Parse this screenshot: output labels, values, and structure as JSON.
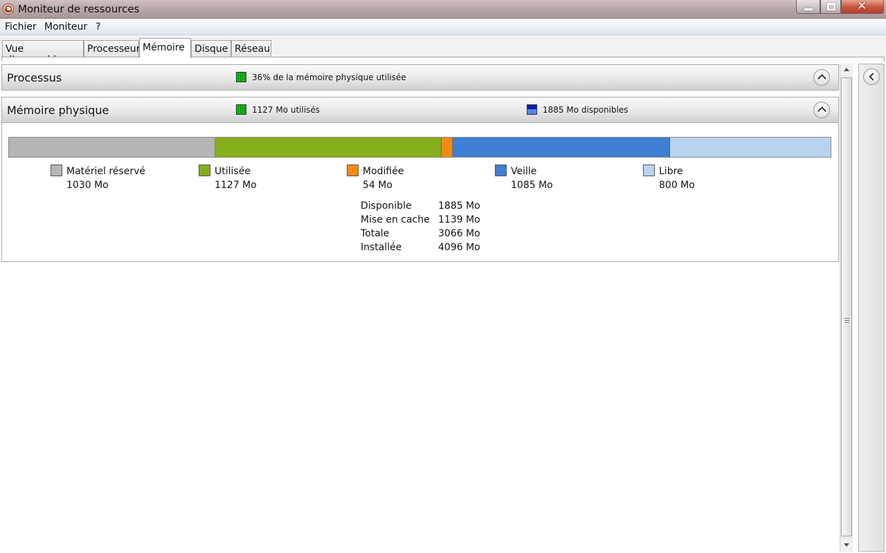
{
  "window": {
    "title": "Moniteur de ressources"
  },
  "menu": [
    "Fichier",
    "Moniteur",
    "?"
  ],
  "tabs": [
    "Vue d’ensemble",
    "Processeur",
    "Mémoire",
    "Disque",
    "Réseau"
  ],
  "active_tab": "Mémoire",
  "processus": {
    "title": "Processus",
    "info": "36% de la mémoire physique utilisée"
  },
  "memoire_physique": {
    "title": "Mémoire physique",
    "used_info": "1127 Mo utilisés",
    "available_info": "1885 Mo disponibles",
    "breakdown": [
      {
        "label": "Matériel réservé",
        "value": "1030 Mo",
        "mb": 1030,
        "color": "#b5b5b5"
      },
      {
        "label": "Utilisée",
        "value": "1127 Mo",
        "mb": 1127,
        "color": "#86ad1a"
      },
      {
        "label": "Modifiée",
        "value": "54 Mo",
        "mb": 54,
        "color": "#f08c12"
      },
      {
        "label": "Veille",
        "value": "1085 Mo",
        "mb": 1085,
        "color": "#3e7fd2"
      },
      {
        "label": "Libre",
        "value": "800 Mo",
        "mb": 800,
        "color": "#b9d2ef"
      }
    ],
    "stats": [
      {
        "label": "Disponible",
        "value": "1885 Mo"
      },
      {
        "label": "Mise en cache",
        "value": "1139 Mo"
      },
      {
        "label": "Totale",
        "value": "3066 Mo"
      },
      {
        "label": "Installée",
        "value": "4096 Mo"
      }
    ]
  }
}
